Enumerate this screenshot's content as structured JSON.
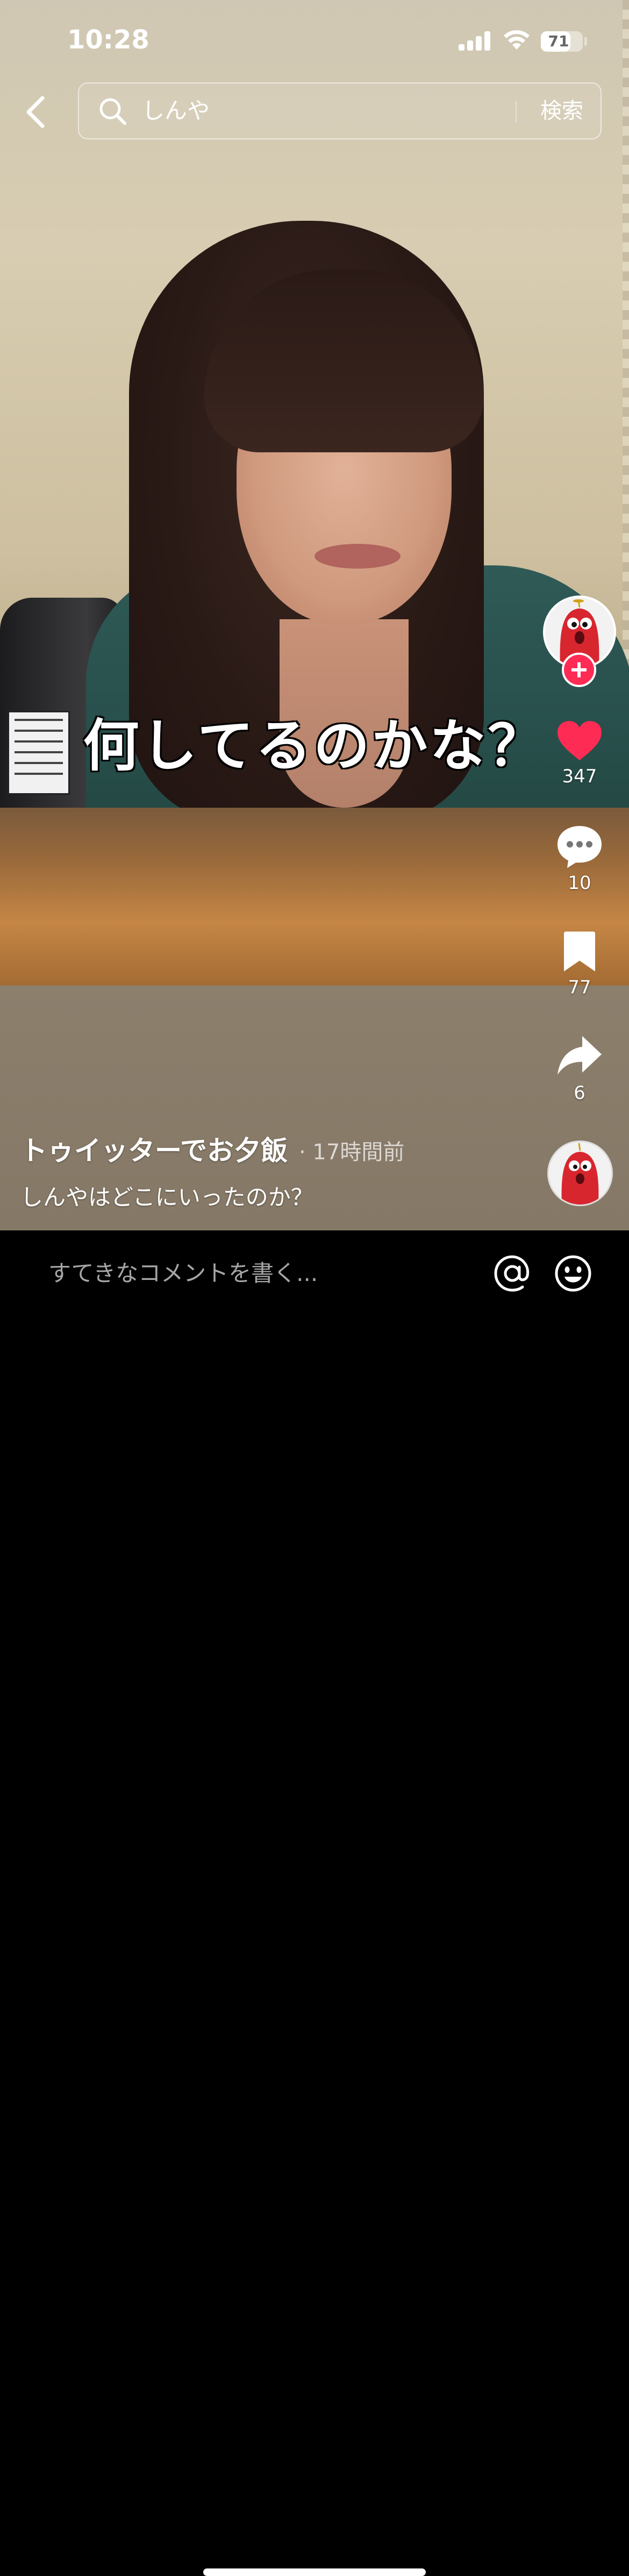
{
  "status_bar": {
    "time": "10:28",
    "battery": "71",
    "battery_level": 0.71
  },
  "search": {
    "query": "しんや",
    "button_label": "検索"
  },
  "video": {
    "caption": "何してるのかな？"
  },
  "actions": {
    "likes": "347",
    "comments": "10",
    "saves": "77",
    "shares": "6"
  },
  "post": {
    "author": "トゥイッターでお夕飯",
    "time_ago": "· 17時間前",
    "description": "しんやはどこにいったのか？"
  },
  "comment_bar": {
    "placeholder": "すてきなコメントを書く..."
  },
  "colors": {
    "accent": "#fe2c55",
    "background": "#000000"
  },
  "icons": [
    "back-icon",
    "search-icon",
    "heart-icon",
    "comment-icon",
    "bookmark-icon",
    "share-icon",
    "mention-icon",
    "emoji-icon"
  ]
}
